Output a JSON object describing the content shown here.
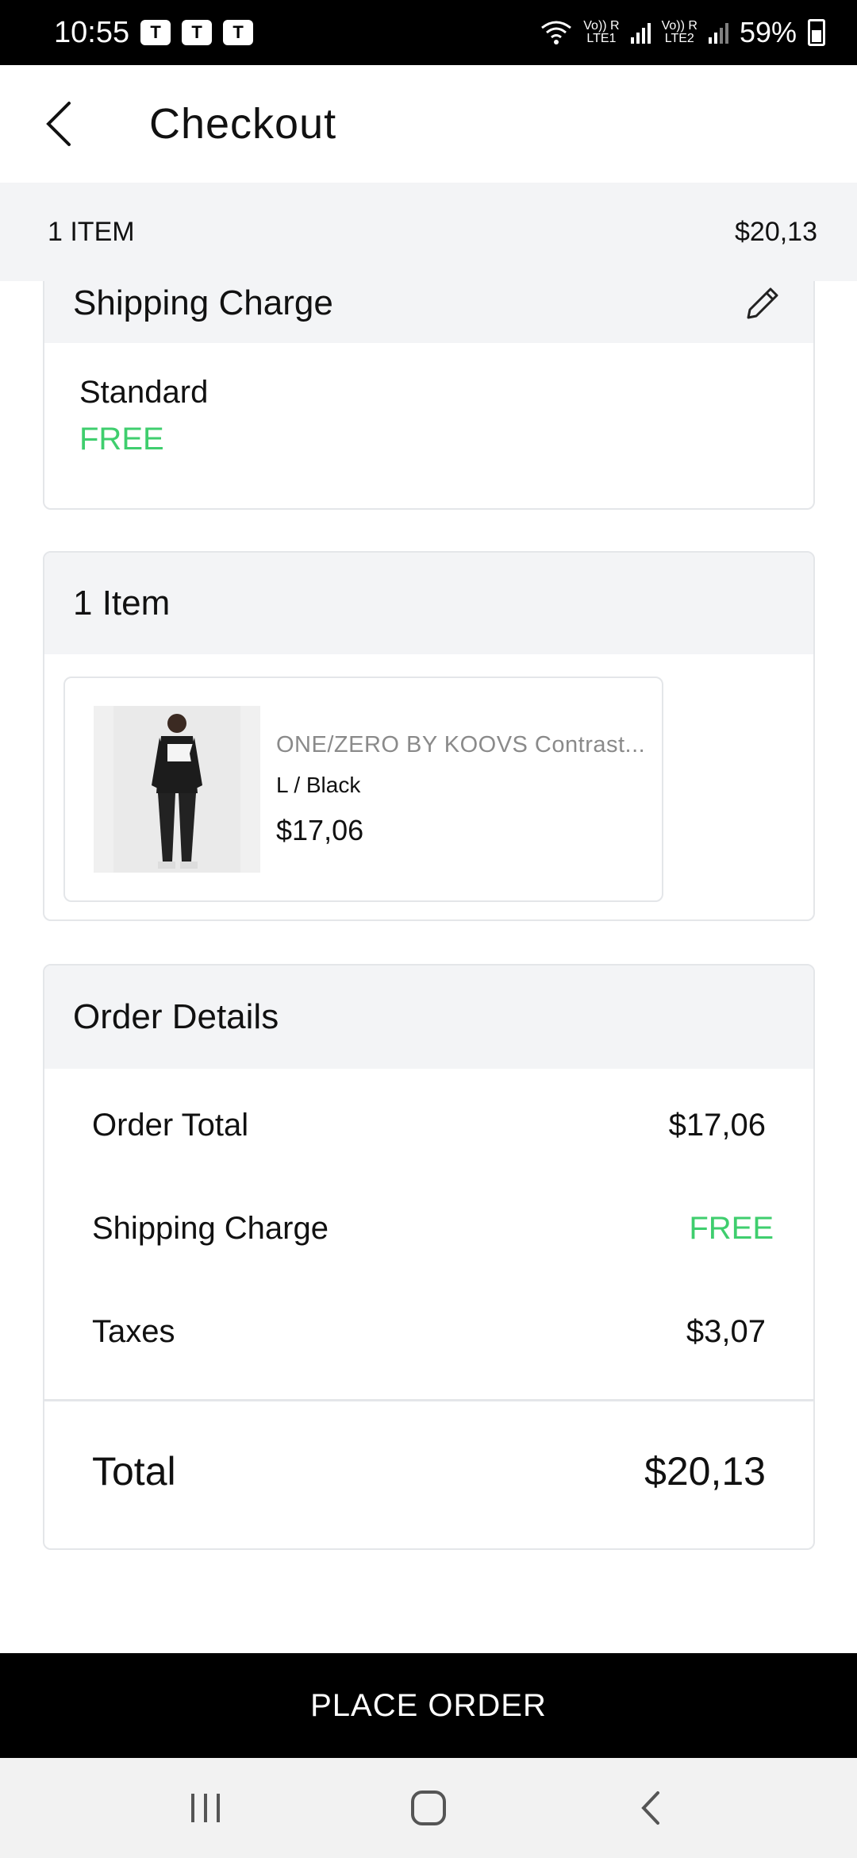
{
  "status_bar": {
    "time": "10:55",
    "network1": "Vo)) R\nLTE1",
    "network2": "Vo)) R\nLTE2",
    "battery": "59%",
    "notification_icons": [
      "teams-icon",
      "teams-icon",
      "teams-icon"
    ]
  },
  "header": {
    "title": "Checkout"
  },
  "summary": {
    "items_label": "1 ITEM",
    "amount": "$20,13"
  },
  "shipping": {
    "title": "Shipping Charge",
    "method": "Standard",
    "price": "FREE"
  },
  "items": {
    "title": "1 Item",
    "list": [
      {
        "name": "ONE/ZERO BY KOOVS Contrast...",
        "variant": "L / Black",
        "price": "$17,06"
      }
    ]
  },
  "order_details": {
    "title": "Order Details",
    "rows": [
      {
        "label": "Order Total",
        "value": "$17,06"
      },
      {
        "label": "Shipping Charge",
        "value": "FREE"
      },
      {
        "label": "Taxes",
        "value": "$3,07"
      }
    ],
    "total_label": "Total",
    "total_value": "$20,13"
  },
  "cta": {
    "label": "PLACE ORDER"
  },
  "colors": {
    "accent_free": "#3fce6e",
    "header_bg": "#f3f4f6",
    "cta_bg": "#000000"
  }
}
